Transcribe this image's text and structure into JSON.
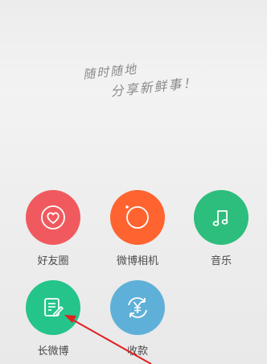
{
  "slogan": {
    "line1": "随时随地",
    "line2": "分享新鲜事！"
  },
  "menu": [
    {
      "id": "friend-circle",
      "label": "好友圈",
      "icon": "heart-circle-icon",
      "color": "#f05a5f"
    },
    {
      "id": "weibo-camera",
      "label": "微博相机",
      "icon": "camera-lens-icon",
      "color": "#ff6430"
    },
    {
      "id": "music",
      "label": "音乐",
      "icon": "music-note-icon",
      "color": "#2dbd7c"
    },
    {
      "id": "long-weibo",
      "label": "长微博",
      "icon": "edit-document-icon",
      "color": "#25c48a"
    },
    {
      "id": "collect-payment",
      "label": "收款",
      "icon": "yuan-refresh-icon",
      "color": "#5fb0d8"
    }
  ],
  "annotation": {
    "arrow_color": "#e0201e"
  }
}
